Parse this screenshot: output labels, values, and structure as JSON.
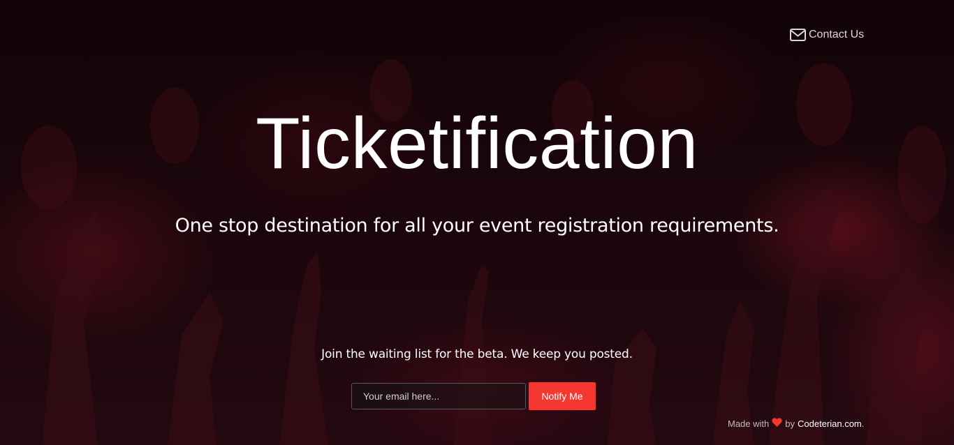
{
  "header": {
    "contact_label": "Contact Us",
    "contact_icon": "envelope-icon"
  },
  "hero": {
    "title": "Ticketification",
    "subtitle": "One stop destination for all your event registration requirements."
  },
  "signup": {
    "prompt": "Join the waiting list for the beta. We keep you posted.",
    "email_placeholder": "Your email here...",
    "email_value": "",
    "button_label": "Notify Me"
  },
  "footer": {
    "made_with": "Made with",
    "heart_icon": "heart-icon",
    "by": "by",
    "brand": "Codeterian.com",
    "period": "."
  },
  "colors": {
    "accent": "#f43831",
    "text": "#ffffff",
    "background": "#120407"
  }
}
